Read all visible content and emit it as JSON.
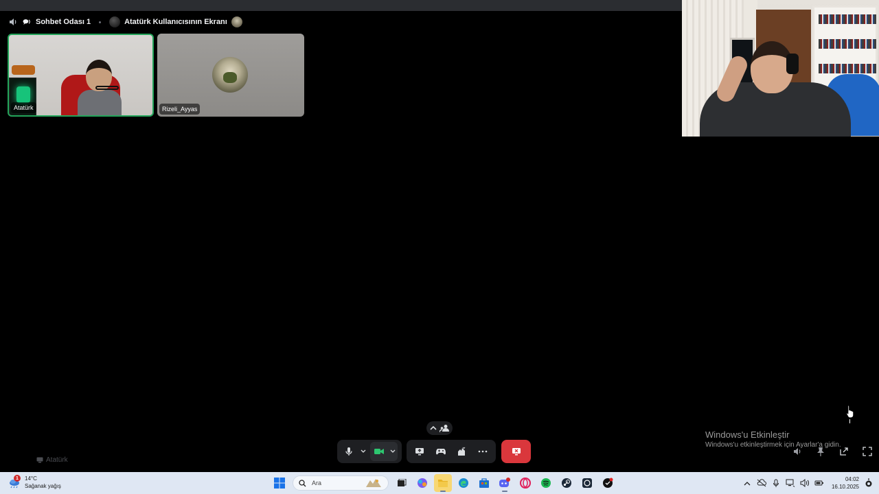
{
  "call": {
    "channel_name": "Sohbet Odası 1",
    "stream_title": "Atatürk Kullanıcısının Ekranı"
  },
  "participants": [
    {
      "name": "Atatürk",
      "speaking": true
    },
    {
      "name": "Rizeli_Ayyas",
      "speaking": false
    }
  ],
  "self_label": "Atatürk",
  "watermark": {
    "title": "Windows'u Etkinleştir",
    "subtitle": "Windows'u etkinleştirmek için Ayarlar'a gidin."
  },
  "taskbar": {
    "weather_badge": "1",
    "weather_temp": "14°C",
    "weather_desc": "Sağanak yağış",
    "search_placeholder": "Ara",
    "time": "04:02",
    "date": "16.10.2025"
  },
  "colors": {
    "speaking_border": "#23a55a",
    "disconnect": "#da373c",
    "panel": "#1e1f22",
    "taskbar": "#dfe7f3"
  }
}
